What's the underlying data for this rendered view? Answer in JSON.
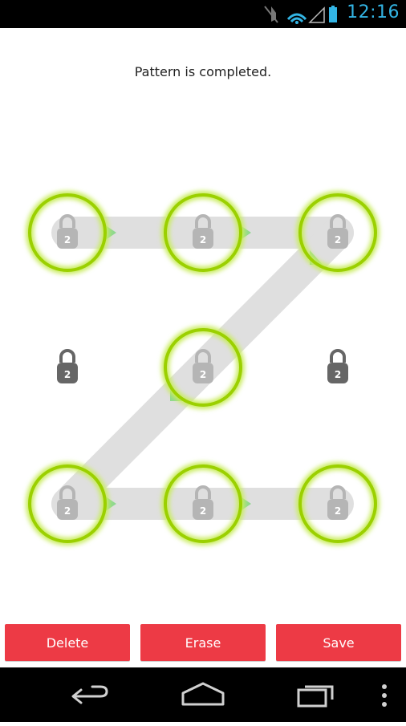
{
  "status": {
    "time": "12:16"
  },
  "message": "Pattern is completed.",
  "lock_label": "2",
  "buttons": {
    "delete": "Delete",
    "erase": "Erase",
    "save": "Save"
  },
  "colors": {
    "accent_time": "#33b5e5",
    "ring": "#a6d51a",
    "button": "#ed3a45",
    "path": "#dcdcdc",
    "arrow": "#8fd88f"
  },
  "pattern": {
    "selected": [
      1,
      2,
      3,
      5,
      7,
      8,
      9
    ],
    "unselected": [
      4,
      6
    ]
  }
}
